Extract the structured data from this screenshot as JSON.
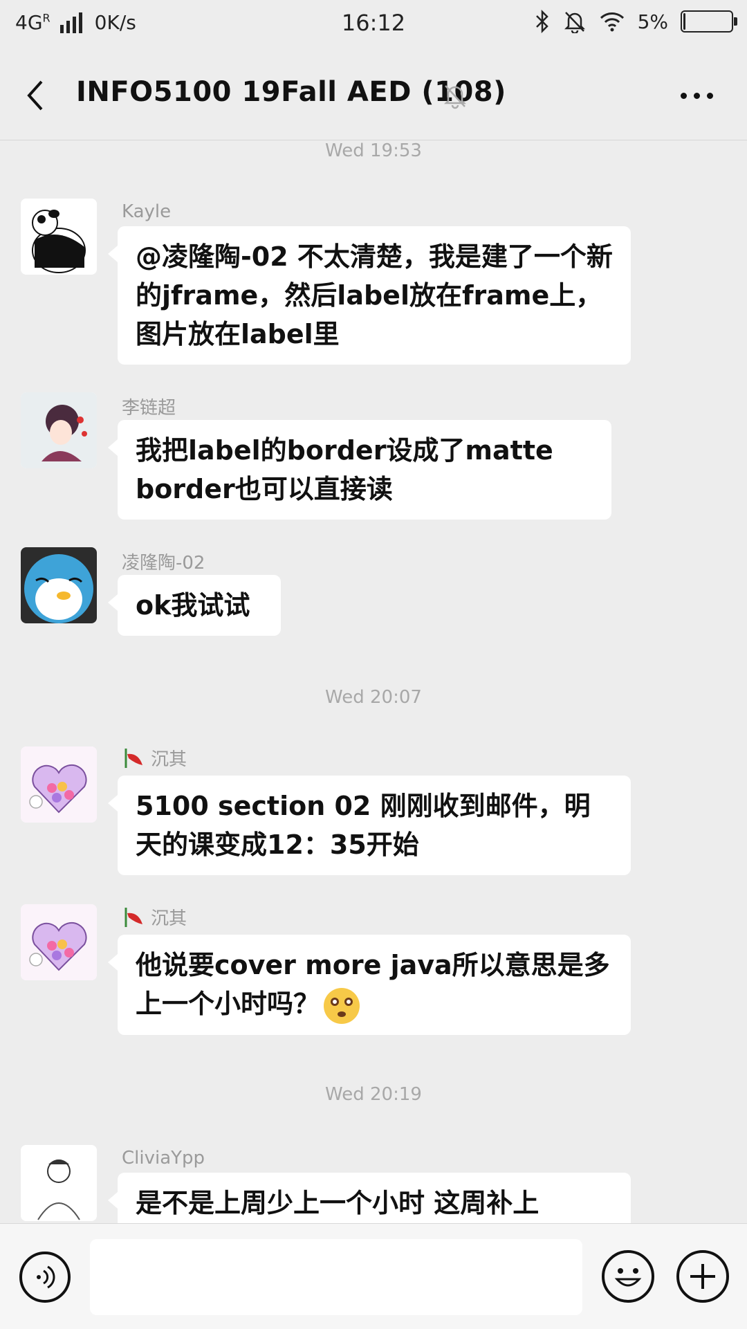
{
  "status_bar": {
    "network": "4G",
    "network_sup": "R",
    "speed": "0K/s",
    "time": "16:12",
    "battery_pct_label": "5%",
    "battery_level": 0.05
  },
  "header": {
    "title": "INFO5100 19Fall AED (108)"
  },
  "messages": [
    {
      "timestamp": "Wed 19:53"
    },
    {
      "sender": "Kayle",
      "text": "@凌隆陶-02 不太清楚，我是建了一个新的jframe，然后label放在frame上，图片放在label里"
    },
    {
      "sender": "李链超",
      "text": "我把label的border设成了matte border也可以直接读"
    },
    {
      "sender": "凌隆陶-02",
      "text": "ok我试试"
    },
    {
      "timestamp": "Wed 20:07"
    },
    {
      "sender": "沉其",
      "text": "5100 section 02 刚刚收到邮件，明天的课变成12：35开始"
    },
    {
      "sender": "沉其",
      "text": "他说要cover more java所以意思是多上一个小时吗？"
    },
    {
      "timestamp": "Wed 20:19"
    },
    {
      "sender": "CliviaYpp",
      "text": "是不是上周少上一个小时 这周补上"
    }
  ],
  "colors": {
    "background": "#ededed",
    "bubble": "#ffffff",
    "timestamp": "#a8a8a8"
  }
}
